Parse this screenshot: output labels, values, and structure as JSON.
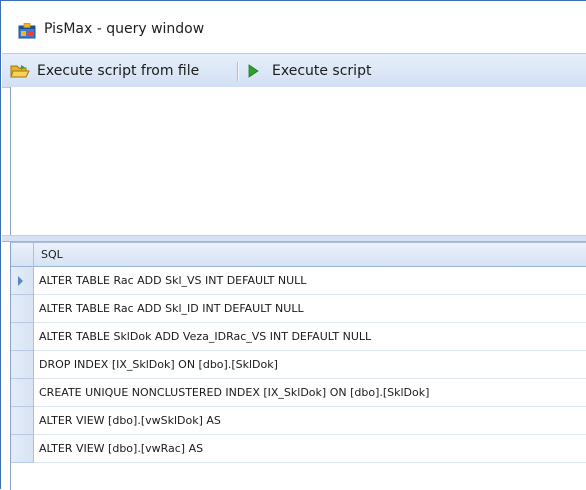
{
  "window": {
    "title": "PisMax - query window"
  },
  "toolbar": {
    "execute_file_label": "Execute script from file",
    "execute_label": "Execute script"
  },
  "editor": {
    "content": ""
  },
  "grid": {
    "column_header": "SQL",
    "rows": [
      "ALTER TABLE Rac ADD Skl_VS INT DEFAULT NULL",
      "ALTER TABLE Rac ADD Skl_ID INT DEFAULT NULL",
      "ALTER TABLE SklDok ADD Veza_IDRac_VS INT DEFAULT NULL",
      "DROP INDEX [IX_SklDok] ON [dbo].[SklDok]",
      "CREATE UNIQUE NONCLUSTERED INDEX [IX_SklDok] ON [dbo].[SklDok]",
      "ALTER VIEW [dbo].[vwSklDok] AS",
      "ALTER VIEW [dbo].[vwRac] AS"
    ],
    "current_row_index": 0
  },
  "icons": {
    "app": "app-window-icon",
    "open_folder": "folder-open-icon",
    "play": "play-icon"
  },
  "colors": {
    "toolbar_bg": "#d3e0f3",
    "accent_border": "#3a6fb0",
    "play_green": "#2ea02e",
    "folder_yellow": "#e8b422"
  }
}
